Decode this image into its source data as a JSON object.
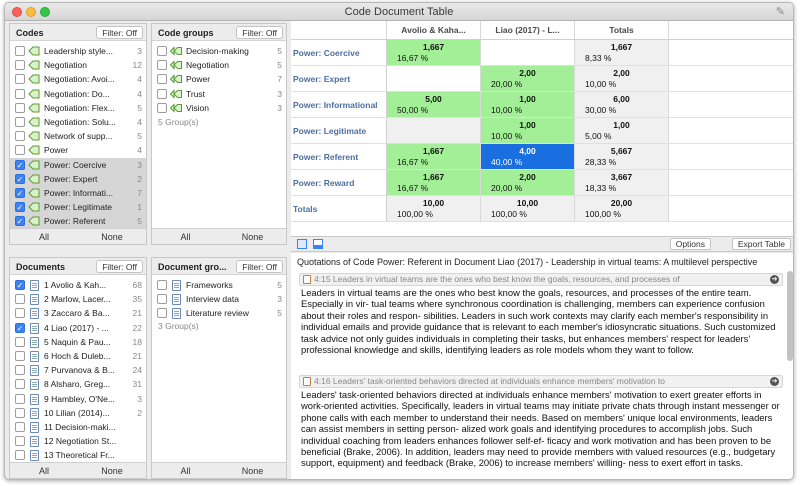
{
  "window": {
    "title": "Code Document Table"
  },
  "codes_panel": {
    "title": "Codes",
    "filter_label": "Filter: Off",
    "items": [
      {
        "label": "Leadership style...",
        "count": "3",
        "checked": false,
        "selected": false
      },
      {
        "label": "Negotiation",
        "count": "12",
        "checked": false,
        "selected": false
      },
      {
        "label": "Negotiation: Avoi...",
        "count": "4",
        "checked": false,
        "selected": false
      },
      {
        "label": "Negotiation: Do...",
        "count": "4",
        "checked": false,
        "selected": false
      },
      {
        "label": "Negotiation: Flex...",
        "count": "5",
        "checked": false,
        "selected": false
      },
      {
        "label": "Negotiation: Solu...",
        "count": "4",
        "checked": false,
        "selected": false
      },
      {
        "label": "Network of supp...",
        "count": "5",
        "checked": false,
        "selected": false
      },
      {
        "label": "Power",
        "count": "4",
        "checked": false,
        "selected": false
      },
      {
        "label": "Power: Coercive",
        "count": "3",
        "checked": true,
        "selected": true
      },
      {
        "label": "Power: Expert",
        "count": "2",
        "checked": true,
        "selected": true
      },
      {
        "label": "Power: Informati...",
        "count": "7",
        "checked": true,
        "selected": true
      },
      {
        "label": "Power: Legitimate",
        "count": "1",
        "checked": true,
        "selected": true
      },
      {
        "label": "Power: Referent",
        "count": "5",
        "checked": true,
        "selected": true
      }
    ],
    "all_label": "All",
    "none_label": "None"
  },
  "code_groups_panel": {
    "title": "Code groups",
    "filter_label": "Filter: Off",
    "items": [
      {
        "label": "Decision-making",
        "count": "5"
      },
      {
        "label": "Negotiation",
        "count": "5"
      },
      {
        "label": "Power",
        "count": "7"
      },
      {
        "label": "Trust",
        "count": "3"
      },
      {
        "label": "Vision",
        "count": "3"
      }
    ],
    "summary": "5 Group(s)",
    "all_label": "All",
    "none_label": "None"
  },
  "documents_panel": {
    "title": "Documents",
    "filter_label": "Filter: Off",
    "items": [
      {
        "label": "1 Avolio & Kah...",
        "count": "68",
        "checked": true
      },
      {
        "label": "2 Marlow, Lacer...",
        "count": "35",
        "checked": false
      },
      {
        "label": "3 Zaccaro & Ba...",
        "count": "21",
        "checked": false
      },
      {
        "label": "4 Liao (2017) - ...",
        "count": "22",
        "checked": true
      },
      {
        "label": "5 Naquin & Pau...",
        "count": "18",
        "checked": false
      },
      {
        "label": "6 Hoch & Duleb...",
        "count": "21",
        "checked": false
      },
      {
        "label": "7 Purvanova & B...",
        "count": "24",
        "checked": false
      },
      {
        "label": "8 Alsharo, Greg...",
        "count": "31",
        "checked": false
      },
      {
        "label": "9 Hambley, O'Ne...",
        "count": "3",
        "checked": false
      },
      {
        "label": "10 Lilian (2014)...",
        "count": "2",
        "checked": false
      },
      {
        "label": "11 Decision-maki...",
        "count": "",
        "checked": false
      },
      {
        "label": "12 Negotiation St...",
        "count": "",
        "checked": false
      },
      {
        "label": "13 Theoretical Fr...",
        "count": "",
        "checked": false
      }
    ],
    "all_label": "All",
    "none_label": "None"
  },
  "doc_groups_panel": {
    "title": "Document gro...",
    "filter_label": "Filter: Off",
    "items": [
      {
        "label": "Frameworks",
        "count": "5"
      },
      {
        "label": "Interview data",
        "count": "3"
      },
      {
        "label": "Literature review",
        "count": "5"
      }
    ],
    "summary": "3 Group(s)",
    "all_label": "All",
    "none_label": "None"
  },
  "table": {
    "columns": [
      "Avolio & Kaha...",
      "Liao (2017) - L...",
      "Totals"
    ],
    "rows": [
      {
        "label": "Power: Coercive",
        "cells": [
          {
            "v": "1,667",
            "p": "16,67 %",
            "s": "green"
          },
          {
            "v": "",
            "p": "",
            "s": "empty"
          },
          {
            "v": "1,667",
            "p": "8,33 %",
            "s": "tot"
          }
        ]
      },
      {
        "label": "Power: Expert",
        "cells": [
          {
            "v": "",
            "p": "",
            "s": "empty"
          },
          {
            "v": "2,00",
            "p": "20,00 %",
            "s": "green"
          },
          {
            "v": "2,00",
            "p": "10,00 %",
            "s": "tot"
          }
        ]
      },
      {
        "label": "Power: Informational",
        "cells": [
          {
            "v": "5,00",
            "p": "50,00 %",
            "s": "green"
          },
          {
            "v": "1,00",
            "p": "10,00 %",
            "s": "green"
          },
          {
            "v": "6,00",
            "p": "30,00 %",
            "s": "tot"
          }
        ]
      },
      {
        "label": "Power: Legitimate",
        "cells": [
          {
            "v": "",
            "p": "",
            "s": "gray"
          },
          {
            "v": "1,00",
            "p": "10,00 %",
            "s": "green"
          },
          {
            "v": "1,00",
            "p": "5,00 %",
            "s": "tot"
          }
        ]
      },
      {
        "label": "Power: Referent",
        "cells": [
          {
            "v": "1,667",
            "p": "16,67 %",
            "s": "green"
          },
          {
            "v": "4,00",
            "p": "40,00 %",
            "s": "blue"
          },
          {
            "v": "5,667",
            "p": "28,33 %",
            "s": "tot"
          }
        ]
      },
      {
        "label": "Power: Reward",
        "cells": [
          {
            "v": "1,667",
            "p": "16,67 %",
            "s": "green"
          },
          {
            "v": "2,00",
            "p": "20,00 %",
            "s": "green"
          },
          {
            "v": "3,667",
            "p": "18,33 %",
            "s": "tot"
          }
        ]
      },
      {
        "label": "Totals",
        "cells": [
          {
            "v": "10,00",
            "p": "100,00 %",
            "s": "tot"
          },
          {
            "v": "10,00",
            "p": "100,00 %",
            "s": "tot"
          },
          {
            "v": "20,00",
            "p": "100,00 %",
            "s": "tot"
          }
        ]
      }
    ]
  },
  "toolbar": {
    "options_label": "Options",
    "export_label": "Export Table"
  },
  "quotations": {
    "header": "Quotations of Code Power: Referent in Document Liao (2017) - Leadership in virtual teams: A multilevel perspective",
    "items": [
      {
        "ref": "4:15 Leaders in virtual teams are the ones who best know the goals, resources, and processes of",
        "text": "Leaders in virtual teams are the ones who best know the goals, resources, and processes of the entire team. Especially in vir- tual teams where synchronous coordination is challenging, members can experience confusion about their roles and respon- sibilities. Leaders in such work contexts may clarify each member's responsibility in individual emails and provide guidance that is relevant to each member's idiosyncratic situations. Such customized task advice not only guides individuals in completing their tasks, but enhances members' respect for leaders' professional knowledge and skills, identifying leaders as role models whom they want to follow."
      },
      {
        "ref": "4:16 Leaders' task-oriented behaviors directed at individuals enhance members' motivation to",
        "text": "Leaders' task-oriented behaviors directed at individuals enhance members' motivation to exert greater efforts in work-oriented activities. Specifically, leaders in virtual teams may initiate private chats through instant messenger or phone calls with each member to understand their needs. Based on members' unique local environments, leaders can assist members in setting person- alized work goals and identifying procedures to accomplish jobs. Such individual coaching from leaders enhances follower self-ef- ficacy and work motivation and has been proven to be beneficial (Brake, 2006). In addition, leaders may need to provide members with valued resources (e.g., budgetary support, equipment) and feedback (Brake, 2006) to increase members' willing- ness to exert effort in tasks."
      }
    ]
  }
}
